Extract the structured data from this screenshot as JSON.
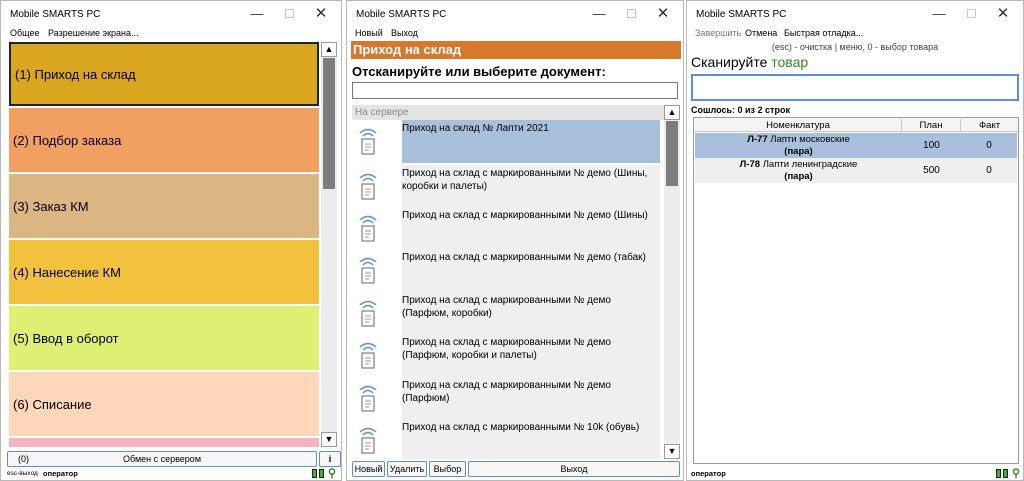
{
  "window1": {
    "title": "Mobile SMARTS PC",
    "menu": [
      "Общее",
      "Разрешение экрана..."
    ],
    "tiles": [
      {
        "label": "(1) Приход на склад",
        "color": "#dba61f"
      },
      {
        "label": "(2) Подбор заказа",
        "color": "#f2a061"
      },
      {
        "label": "(3) Заказ КМ",
        "color": "#dbb582"
      },
      {
        "label": "(4) Нанесение КМ",
        "color": "#f2c23f"
      },
      {
        "label": "(5) Ввод в оборот",
        "color": "#deef73"
      },
      {
        "label": "(6) Списание",
        "color": "#fed6b9"
      }
    ],
    "exchange_count": "(0)",
    "exchange_label": "Обмен с сервером",
    "info_label": "i",
    "status_left": "esc-выход",
    "status_user": "оператор"
  },
  "window2": {
    "title": "Mobile SMARTS PC",
    "menu": [
      "Новый",
      "Выход"
    ],
    "header": "Приход на склад",
    "prompt": "Отсканируйте или выберите документ:",
    "group_label": "На сервере",
    "documents": [
      "Приход на склад № Лапти 2021",
      "Приход на склад с маркированными № демо (Шины, коробки и палеты)",
      "Приход на склад с маркированными № демо (Шины)",
      "Приход на склад с маркированными № демо (табак)",
      "Приход на склад с маркированными № демо (Парфюм, коробки)",
      "Приход на склад с маркированными № демо (Парфюм, коробки и палеты)",
      "Приход на склад с маркированными № демо (Парфюм)",
      "Приход на склад с маркированными № 10k (обувь)"
    ],
    "buttons": [
      "Новый",
      "Удалить",
      "Выбор",
      "Выход"
    ]
  },
  "window3": {
    "title": "Mobile SMARTS PC",
    "menu": [
      "Завершить",
      "Отмена",
      "Быстрая отладка..."
    ],
    "hint": "(esc) - очистка | меню, 0 - выбор товара",
    "scan_prefix": "Сканируйте",
    "scan_highlight": "товар",
    "found": "Сошлось: 0 из 2 строк",
    "columns": [
      "Номенклатура",
      "План",
      "Факт"
    ],
    "rows": [
      {
        "code": "Л-77",
        "name": "Лапти московские",
        "unit": "(пара)",
        "plan": "100",
        "fact": "0"
      },
      {
        "code": "Л-78",
        "name": "Лапти ленинградские",
        "unit": "(пара)",
        "plan": "500",
        "fact": "0"
      }
    ],
    "status_user": "оператор"
  },
  "colors": {
    "accent_orange": "#d6792c",
    "selection_blue": "#a9c0dc",
    "button_border": "#5b8fd6",
    "scan_green": "#2f8a22"
  }
}
